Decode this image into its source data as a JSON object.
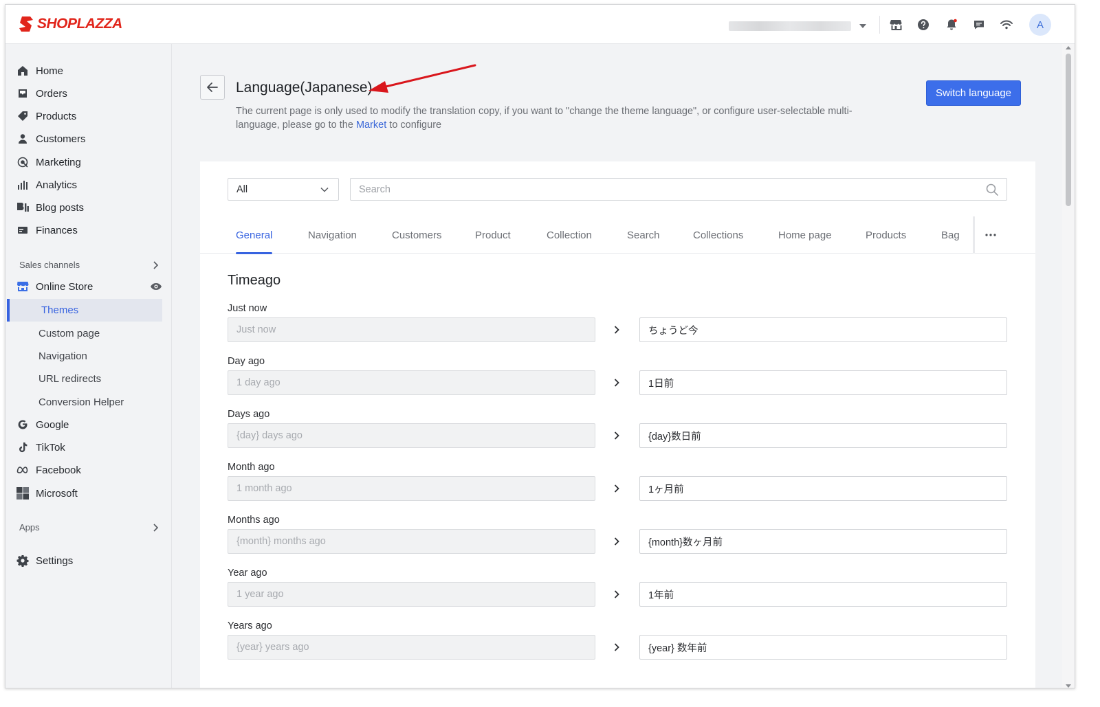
{
  "brand": {
    "name": "SHOPLAZZA",
    "color": "#e1251b"
  },
  "topbar": {
    "icons": [
      "store-icon",
      "help-icon",
      "bell-icon",
      "chat-icon",
      "wifi-icon"
    ],
    "avatar_letter": "A"
  },
  "sidebar": {
    "items": [
      {
        "label": "Home",
        "icon": "home-icon"
      },
      {
        "label": "Orders",
        "icon": "inbox-icon"
      },
      {
        "label": "Products",
        "icon": "tag-icon"
      },
      {
        "label": "Customers",
        "icon": "person-icon"
      },
      {
        "label": "Marketing",
        "icon": "target-icon"
      },
      {
        "label": "Analytics",
        "icon": "bar-chart-icon"
      },
      {
        "label": "Blog posts",
        "icon": "blog-icon"
      },
      {
        "label": "Finances",
        "icon": "finance-icon"
      }
    ],
    "sales_channels_label": "Sales channels",
    "online_store": {
      "label": "Online Store",
      "icon": "store-icon"
    },
    "online_store_sub": [
      "Themes",
      "Custom page",
      "Navigation",
      "URL redirects",
      "Conversion Helper"
    ],
    "channels": [
      {
        "label": "Google",
        "icon": "google-icon"
      },
      {
        "label": "TikTok",
        "icon": "tiktok-icon"
      },
      {
        "label": "Facebook",
        "icon": "meta-icon"
      },
      {
        "label": "Microsoft",
        "icon": "microsoft-icon"
      }
    ],
    "apps_label": "Apps",
    "settings": {
      "label": "Settings",
      "icon": "gear-icon"
    }
  },
  "header": {
    "title": "Language(Japanese)",
    "desc_before": "The current page is only used to modify the translation copy, if you want to \"change the theme language\", or configure user-selectable multi-language, please go to the ",
    "desc_link": "Market",
    "desc_after": " to configure",
    "switch_button": "Switch language"
  },
  "filter": {
    "selected": "All",
    "search_placeholder": "Search"
  },
  "tabs": [
    "General",
    "Navigation",
    "Customers",
    "Product",
    "Collection",
    "Search",
    "Collections",
    "Home page",
    "Products",
    "Bag"
  ],
  "section": {
    "title": "Timeago",
    "rows": [
      {
        "label": "Just now",
        "source": "Just now",
        "translation": "ちょうど今"
      },
      {
        "label": "Day ago",
        "source": "1 day ago",
        "translation": "1日前"
      },
      {
        "label": "Days ago",
        "source": "{day} days ago",
        "translation": "{day}数日前"
      },
      {
        "label": "Month ago",
        "source": "1 month ago",
        "translation": "1ヶ月前"
      },
      {
        "label": "Months ago",
        "source": "{month} months ago",
        "translation": "{month}数ヶ月前"
      },
      {
        "label": "Year ago",
        "source": "1 year ago",
        "translation": "1年前"
      },
      {
        "label": "Years ago",
        "source": "{year} years ago",
        "translation": "{year} 数年前"
      }
    ]
  },
  "colors": {
    "accent": "#3763e0",
    "button": "#3c6eea",
    "annotation": "#d9161c"
  }
}
